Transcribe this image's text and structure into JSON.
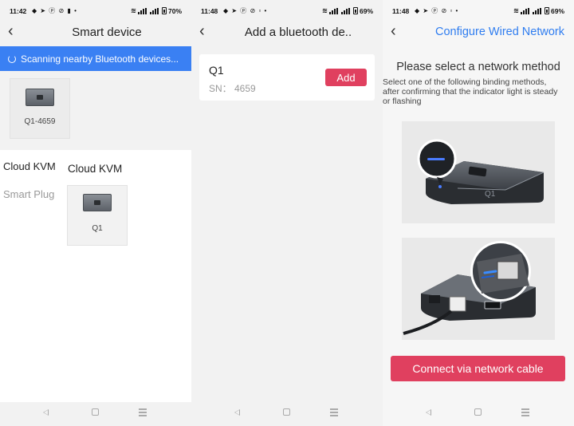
{
  "panel1": {
    "status": {
      "time": "11:42",
      "icons": "◆ ➤ ⓟ ⊘ ▮ •",
      "battery": "70%"
    },
    "title": "Smart device",
    "scan_text": "Scanning nearby Bluetooth devices...",
    "found_device": {
      "label": "Q1-4659"
    },
    "categories": [
      "Cloud KVM",
      "Smart Plug"
    ],
    "category_title": "Cloud KVM",
    "product": {
      "label": "Q1"
    }
  },
  "panel2": {
    "status": {
      "time": "11:48",
      "icons": "◆ ➤ ⓟ ⊘ ▫ •",
      "battery": "69%"
    },
    "title": "Add a bluetooth de..",
    "device": {
      "name": "Q1",
      "sn": "SN： 4659"
    },
    "add_label": "Add"
  },
  "panel3": {
    "status": {
      "time": "11:48",
      "icons": "◆ ➤ ⓟ ⊘ ▫ •",
      "battery": "69%"
    },
    "title": "Configure Wired Network",
    "heading": "Please select a network method",
    "description": [
      "Select one of the following binding methods,",
      "after confirming that the indicator light is steady",
      "or flashing"
    ],
    "connect_label": "Connect via network cable"
  },
  "colors": {
    "accent_blue": "#3a80f3",
    "title_blue": "#2f7df0",
    "action_red": "#e0405f"
  }
}
